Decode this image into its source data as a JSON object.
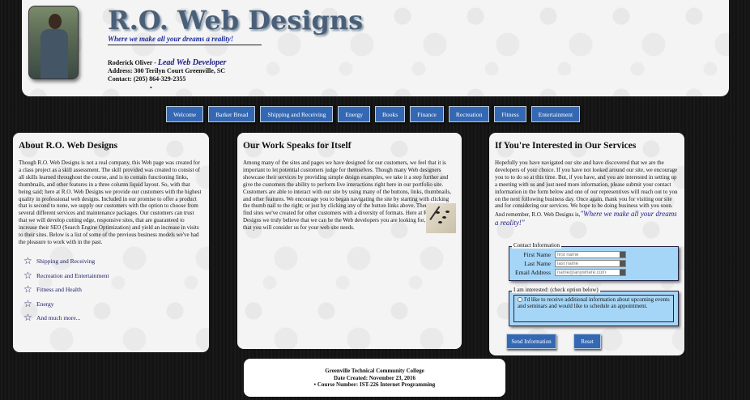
{
  "header": {
    "title": "R.O. Web Designs",
    "tagline": "Where we make all your dreams a reality!",
    "name": "Roderick Oliver - ",
    "role": "Lead Web Developer",
    "address": "Address: 300 Terilyn Court Greenville, SC",
    "phone": "Contact: (205) 864-329-2355",
    "bullet": "•"
  },
  "nav": {
    "items": [
      "Welcome",
      "Barker Bread",
      "Shipping and Receiving",
      "Energy",
      "Books",
      "Finance",
      "Recreation",
      "Fitness",
      "Entertainment"
    ]
  },
  "about": {
    "heading": "About R.O. Web Designs",
    "body": "Though R.O. Web Designs is not a real company, this Web page was created for a class project as a skill assessment. The skill provided was created to consist of all skills learned throughout the course, and is to contain functioning links, thumbnails, and other features in a three column liquid layout. So, with that being said; here at R.O. Web Designs we provide our customers with the highest quality in professional web designs. Included in our promise to offer a product that is second to none, we supply our customers with the option to choose from several different services and maintenance packages. Our customers can trust that we will develop cutting edge, responsive sites, that are guaranteed to increase their SEO (Search Engine Optimization) and yield an increase in visits to their sites. Below is a list of some of the previous business models we've had the pleasure to work with in the past.",
    "services": [
      "Shipping and Receiving",
      "Recreation and Entertainment",
      "Fitness and Health",
      "Energy",
      "And much more..."
    ]
  },
  "work": {
    "heading": "Our Work Speaks for Itself",
    "body_top": "Among many of the sites and pages we have designed for our customers, we feel that it is important to let potential customers judge for themselves. Though many Web designers showcase their services by providing simple design examples, we take it a step further and give the customers the ability to perform live interactions right here in our portfolio site. Customers are able to interact with our site by using many of the buttons, links, thumbnails, and other features. We encourage you to began navigating the site by starting with clicking the thumb nail to the right; or just by clicking any of the button links above. There you will find sites we've created for other customers with a diversity of formats. Here at R.O. Web Designs we truly believe that we can be the Web developers you are looking for, and hope that you will consider us for your web site needs."
  },
  "interest": {
    "heading": "If You're Interested in Our Services",
    "body": "Hopefully you have navigated our site and have discovered that we are the developers of your choice. If you have not looked around our site, we encourage you to to do so at this time. But, if you have, and you are interested in setting up a meeting with us and just need more information, please submit your contact information in the form below and one of our representives will reach out to you on the next following business day. Once again, thank you for visiting our site and for considering our services. We hope to be doing business with you soon. And remember, R.O. Web Designs is,",
    "quote": "\"Where we make all your dreams a reality!\"",
    "contact_legend": "Contact Information",
    "first_label": "First Name",
    "first_placeholder": "first name",
    "last_label": "Last Name",
    "last_placeholder": "last name",
    "email_label": "Email Address",
    "email_placeholder": "name@anywhere.com",
    "interest_legend": "I am interested: (check option below)",
    "checkbox_text": "I'd like to receive additional information about upcoming events and seminars and would like to schedule an appointment.",
    "send_label": "Send Information",
    "reset_label": "Reset"
  },
  "footer": {
    "line1": "Greenville Technical Community College",
    "line2": "Date Created: November 23, 2016",
    "line3": "• Course Number: IST-226 Internet Programming"
  }
}
